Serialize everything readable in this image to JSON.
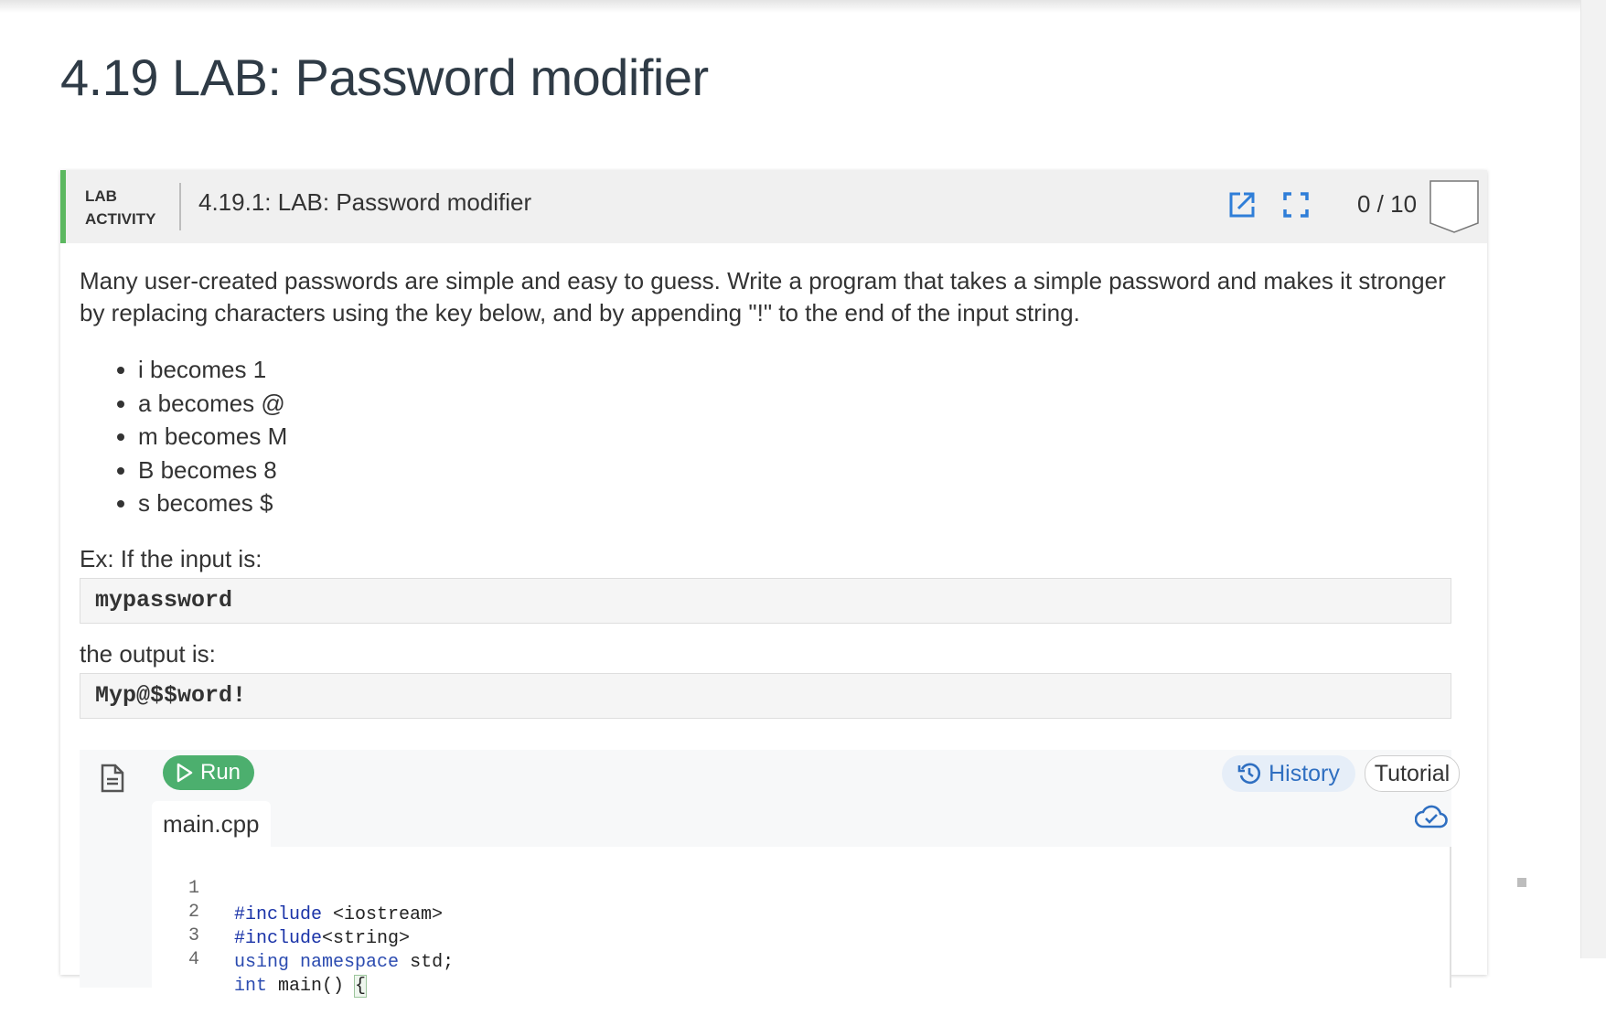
{
  "page": {
    "title": "4.19 LAB: Password modifier"
  },
  "activity": {
    "type_line1": "LAB",
    "type_line2": "ACTIVITY",
    "title": "4.19.1: LAB: Password modifier",
    "score": "0 / 10",
    "accent_color": "#5cb860",
    "icons": [
      "open-new-window-icon",
      "fullscreen-icon",
      "score-shield-icon"
    ]
  },
  "content": {
    "description": "Many user-created passwords are simple and easy to guess. Write a program that takes a simple password and makes it stronger by replacing characters using the key below, and by appending \"!\" to the end of the input string.",
    "key_items": [
      "i becomes 1",
      "a becomes @",
      "m becomes M",
      "B becomes 8",
      "s becomes $"
    ],
    "example_input_label": "Ex: If the input is:",
    "example_input": "mypassword",
    "example_output_label": "the output is:",
    "example_output": "Myp@$$word!"
  },
  "workspace": {
    "run_label": "Run",
    "history_label": "History",
    "tutorial_label": "Tutorial",
    "file_tab": "main.cpp",
    "run_color": "#4caf6e",
    "history_color": "#2f6fc1",
    "code_lines": [
      {
        "num": "1",
        "text": "#include <iostream>"
      },
      {
        "num": "2",
        "text": "#include<string>"
      },
      {
        "num": "3",
        "text": "using namespace std;"
      },
      {
        "num": "4",
        "text": "int main() {"
      }
    ]
  }
}
